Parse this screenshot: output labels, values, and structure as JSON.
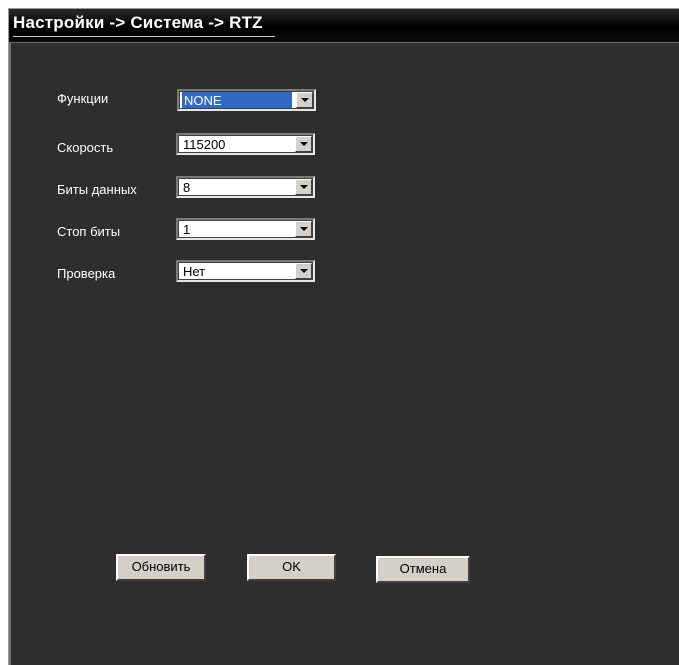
{
  "window": {
    "title": "Настройки -> Система -> RTZ"
  },
  "form": {
    "rows": [
      {
        "label": "Функции",
        "value": "NONE",
        "selected": true
      },
      {
        "label": "Скорость",
        "value": "115200",
        "selected": false
      },
      {
        "label": "Биты данных",
        "value": "8",
        "selected": false
      },
      {
        "label": "Стоп биты",
        "value": "1",
        "selected": false
      },
      {
        "label": "Проверка",
        "value": "Нет",
        "selected": false
      }
    ]
  },
  "buttons": {
    "refresh": "Обновить",
    "ok": "OK",
    "cancel": "Отмена"
  },
  "colors": {
    "panel_bg": "#2e2e2e",
    "title_bg": "#000000",
    "highlight": "#3169c6",
    "button_face": "#d4d0c8"
  },
  "icons": {
    "dropdown": "chevron-down-icon"
  }
}
